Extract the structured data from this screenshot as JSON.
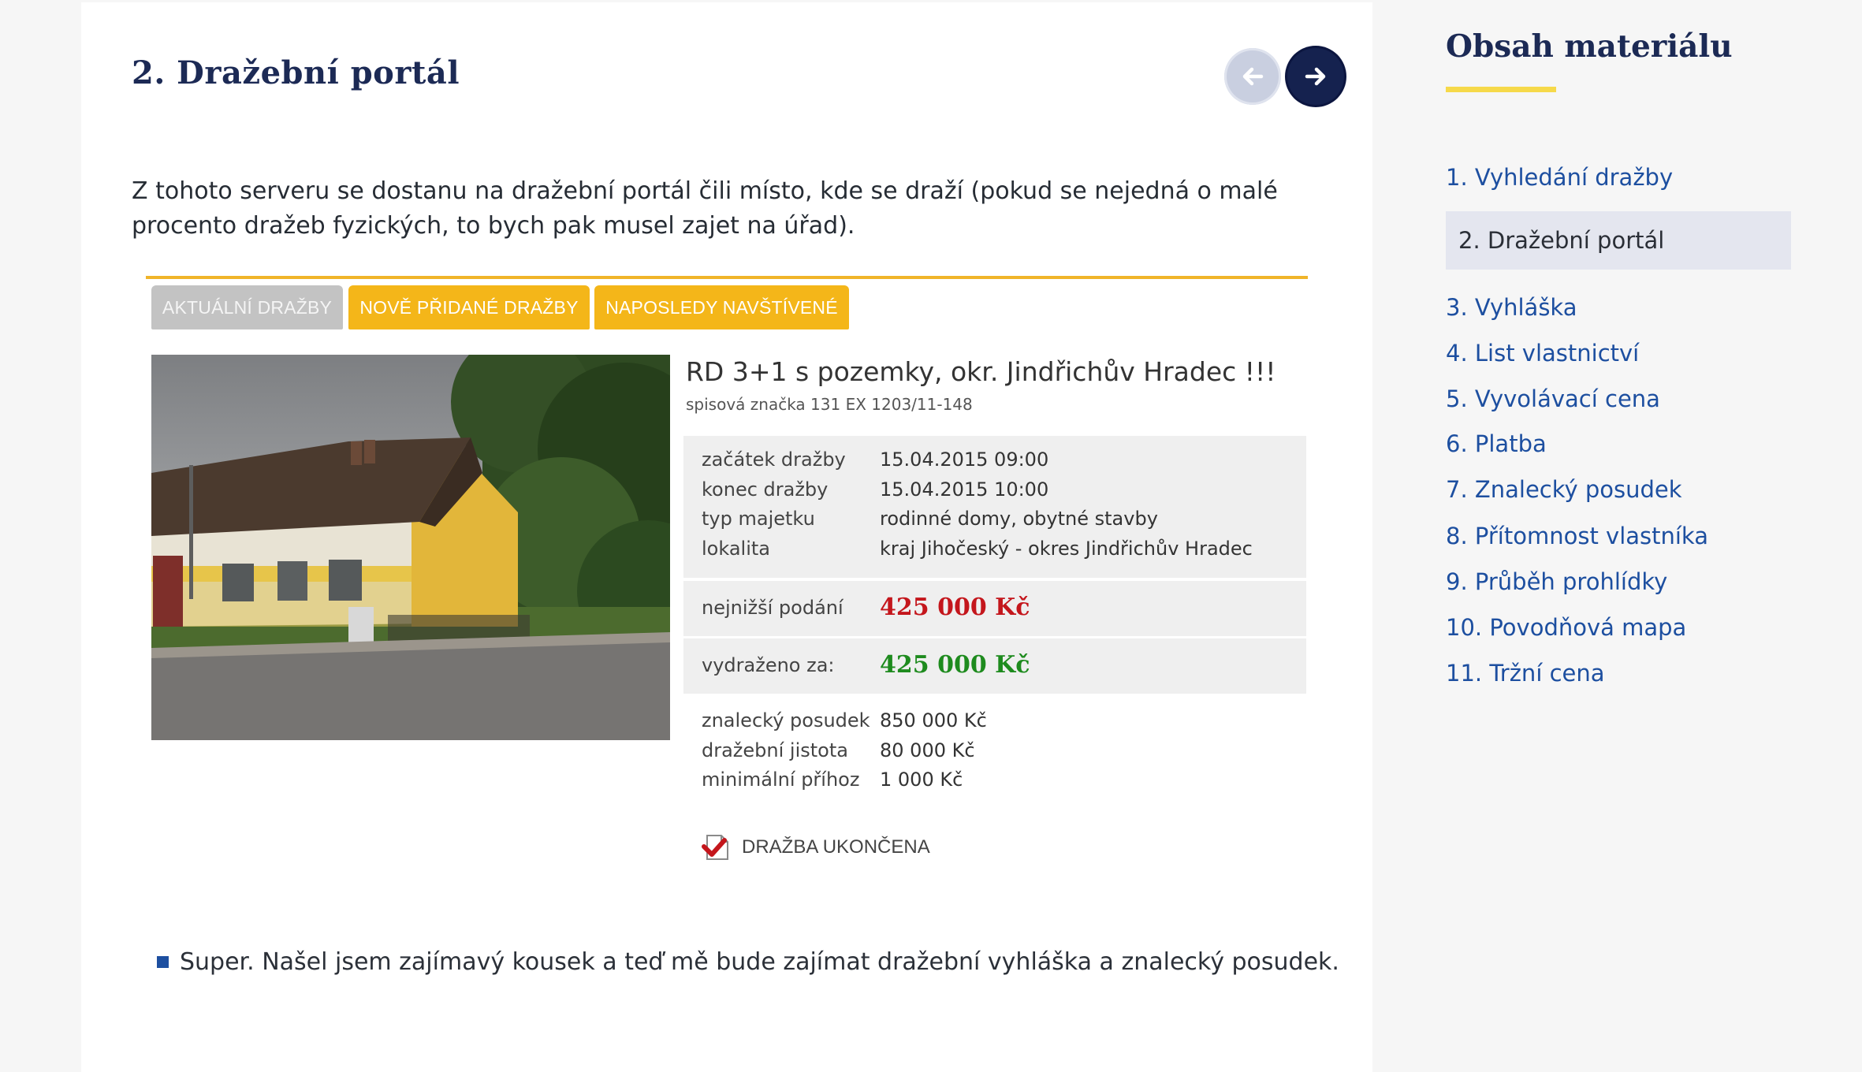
{
  "main": {
    "title": "2. Dražební portál",
    "intro": "Z tohoto serveru se dostanu na dražební portál čili místo, kde se draží (pokud se nejedná o malé procento dražeb fyzických, to bych pak musel zajet na úřad).",
    "bullet_note": "Super. Našel jsem zajímavý kousek a teď mě bude zajímat dražební vyhláška a znalecký posudek."
  },
  "auction": {
    "tabs": [
      {
        "label": "AKTUÁLNÍ DRAŽBY"
      },
      {
        "label": "NOVĚ PŘIDANÉ DRAŽBY"
      },
      {
        "label": "NAPOSLEDY NAVŠTÍVENÉ"
      }
    ],
    "listing_title": "RD 3+1 s pozemky, okr. Jindřichův Hradec !!!",
    "file_number": "spisová značka 131 EX 1203/11-148",
    "details": [
      {
        "label": "začátek dražby",
        "value": "15.04.2015 09:00"
      },
      {
        "label": "konec dražby",
        "value": "15.04.2015 10:00"
      },
      {
        "label": "typ majetku",
        "value": "rodinné domy, obytné stavby"
      },
      {
        "label": "lokalita",
        "value": "kraj Jihočeský - okres Jindřichův Hradec"
      }
    ],
    "lowest_bid_label": "nejnižší podání",
    "lowest_bid_value": "425 000 Kč",
    "sold_for_label": "vydraženo za:",
    "sold_for_value": "425 000 Kč",
    "extra": [
      {
        "label": "znalecký posudek",
        "value": "850 000 Kč"
      },
      {
        "label": "dražební jistota",
        "value": "80 000 Kč"
      },
      {
        "label": "minimální příhoz",
        "value": "1 000 Kč"
      }
    ],
    "status": "DRAŽBA UKONČENA"
  },
  "sidebar": {
    "title": "Obsah materiálu",
    "items": [
      {
        "label": "1. Vyhledání dražby"
      },
      {
        "label": "2. Dražební portál"
      },
      {
        "label": "3. Vyhláška"
      },
      {
        "label": "4. List vlastnictví"
      },
      {
        "label": "5. Vyvolávací cena"
      },
      {
        "label": "6. Platba"
      },
      {
        "label": "7. Znalecký posudek"
      },
      {
        "label": "8. Přítomnost vlastníka"
      },
      {
        "label": "9. Průběh prohlídky"
      },
      {
        "label": "10. Povodňová mapa"
      },
      {
        "label": "11. Tržní cena"
      }
    ]
  },
  "colors": {
    "navy": "#15224f",
    "link": "#1d4fa0",
    "accent_yellow": "#f4b619",
    "price_red": "#c4161c",
    "price_green": "#1e8b1e"
  },
  "icons": {
    "prev": "arrow-left-icon",
    "next": "arrow-right-icon",
    "status": "auction-closed-icon"
  }
}
